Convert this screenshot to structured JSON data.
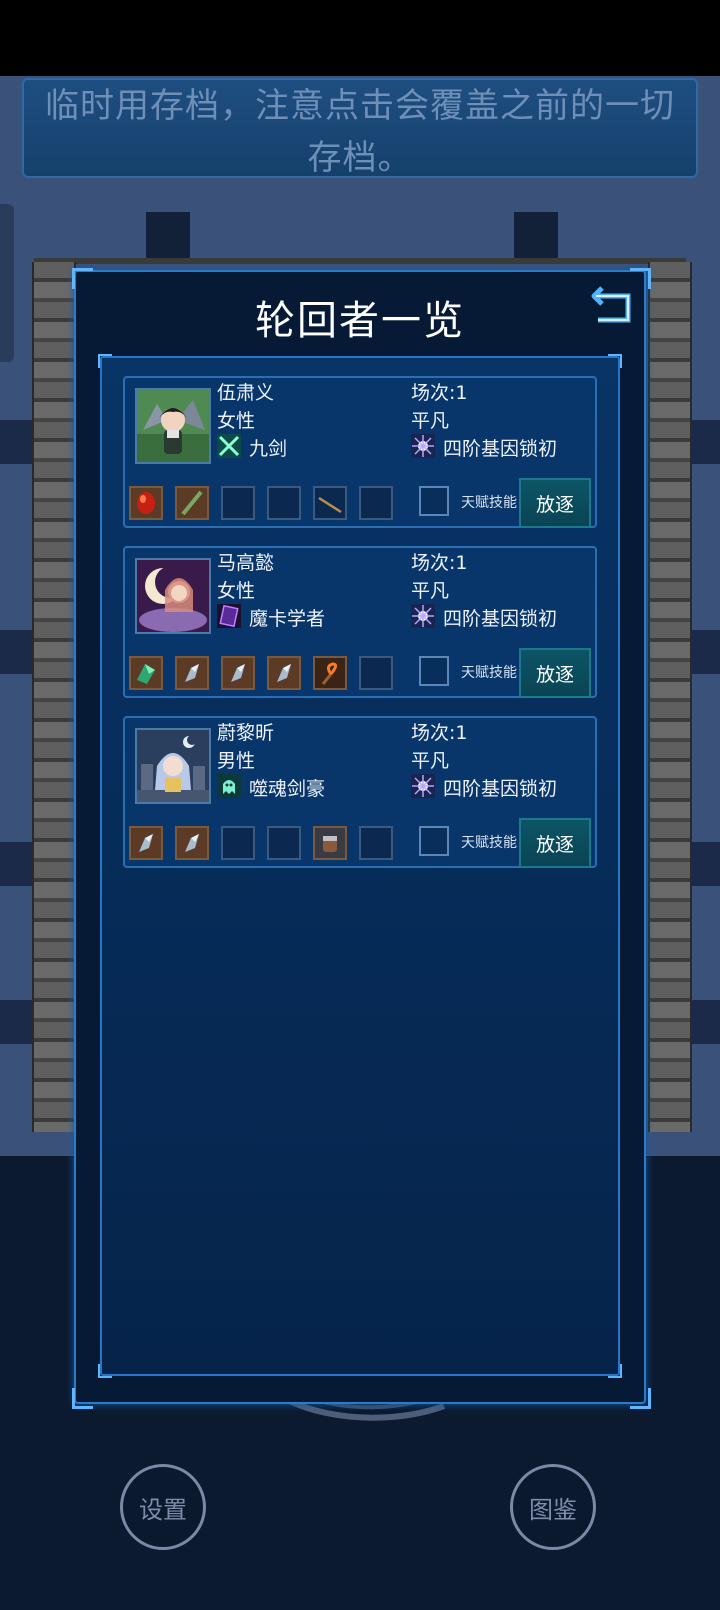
{
  "notice": {
    "line1": "临时用存档，注意点击会覆盖之前的一切",
    "line2": "存档。"
  },
  "panel": {
    "title": "轮回者一览"
  },
  "talent_label": "天赋技能",
  "exile_label": "放逐",
  "characters": [
    {
      "name": "伍肃义",
      "gender": "女性",
      "class_name": "九剑",
      "class_icon": "crossed-swords-icon",
      "round": "场次:1",
      "rank": "平凡",
      "gene": "四阶基因锁初",
      "avatar": "swordswoman-avatar"
    },
    {
      "name": "马高懿",
      "gender": "女性",
      "class_name": "魔卡学者",
      "class_icon": "magic-card-icon",
      "round": "场次:1",
      "rank": "平凡",
      "gene": "四阶基因锁初",
      "avatar": "moon-mage-avatar"
    },
    {
      "name": "蔚黎昕",
      "gender": "男性",
      "class_name": "噬魂剑豪",
      "class_icon": "soul-ghost-icon",
      "round": "场次:1",
      "rank": "平凡",
      "gene": "四阶基因锁初",
      "avatar": "silver-hair-avatar"
    }
  ],
  "buttons": {
    "settings": "设置",
    "catalog": "图鉴"
  },
  "colors": {
    "accent": "#2a7cc8",
    "exile": "#0c5566",
    "panel": "#061a36"
  }
}
